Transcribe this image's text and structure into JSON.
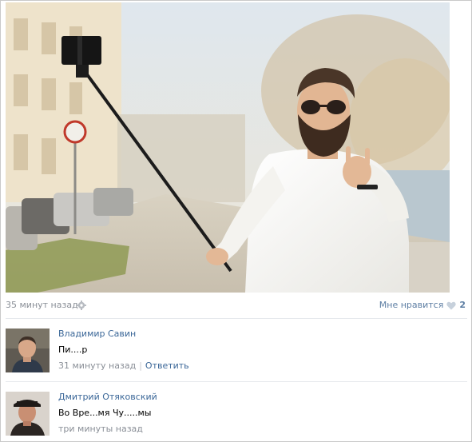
{
  "post": {
    "photo_description_icon": "selfie-stick-photo",
    "timestamp": "35 минут назад",
    "settings_icon": "gear-icon",
    "like_label": "Мне нравится",
    "like_icon": "heart-icon",
    "like_count": "2"
  },
  "comments": [
    {
      "author": "Владимир Савин",
      "text": "Пи....р",
      "timestamp": "31 минуту назад",
      "separator": "|",
      "reply_label": "Ответить"
    },
    {
      "author": "Дмитрий Отяковский",
      "text": "Во Вре...мя Чу.....мы",
      "timestamp": "три минуты назад"
    }
  ],
  "colors": {
    "link": "#3b6798",
    "muted": "#8a8f97",
    "like": "#5d7ea3",
    "divider": "#e6e9ed"
  }
}
